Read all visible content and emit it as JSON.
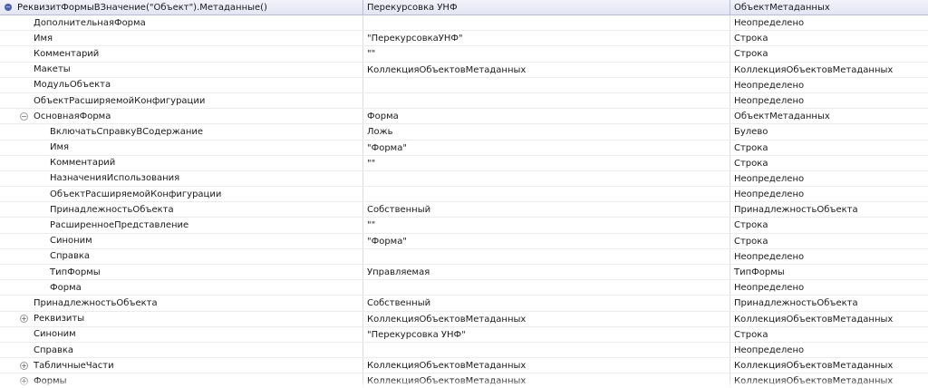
{
  "header": {
    "col1": "РеквизитФормыВЗначение(\"Объект\").Метаданные()",
    "col2": "Перекурсовка УНФ",
    "col3": "ОбъектМетаданных"
  },
  "rows": [
    {
      "level": 1,
      "toggle": "",
      "name": "ДополнительнаяФорма",
      "value": "",
      "type": "Неопределено"
    },
    {
      "level": 1,
      "toggle": "",
      "name": "Имя",
      "value": "\"ПерекурсовкаУНФ\"",
      "type": "Строка"
    },
    {
      "level": 1,
      "toggle": "",
      "name": "Комментарий",
      "value": "\"\"",
      "type": "Строка"
    },
    {
      "level": 1,
      "toggle": "",
      "name": "Макеты",
      "value": "КоллекцияОбъектовМетаданных",
      "type": "КоллекцияОбъектовМетаданных"
    },
    {
      "level": 1,
      "toggle": "",
      "name": "МодульОбъекта",
      "value": "",
      "type": "Неопределено"
    },
    {
      "level": 1,
      "toggle": "",
      "name": "ОбъектРасширяемойКонфигурации",
      "value": "",
      "type": "Неопределено"
    },
    {
      "level": 1,
      "toggle": "⊖",
      "name": "ОсновнаяФорма",
      "value": "Форма",
      "type": "ОбъектМетаданных"
    },
    {
      "level": 2,
      "toggle": "",
      "name": "ВключатьСправкуВСодержание",
      "value": "Ложь",
      "type": "Булево"
    },
    {
      "level": 2,
      "toggle": "",
      "name": "Имя",
      "value": "\"Форма\"",
      "type": "Строка"
    },
    {
      "level": 2,
      "toggle": "",
      "name": "Комментарий",
      "value": "\"\"",
      "type": "Строка"
    },
    {
      "level": 2,
      "toggle": "",
      "name": "НазначенияИспользования",
      "value": "",
      "type": "Неопределено"
    },
    {
      "level": 2,
      "toggle": "",
      "name": "ОбъектРасширяемойКонфигурации",
      "value": "",
      "type": "Неопределено"
    },
    {
      "level": 2,
      "toggle": "",
      "name": "ПринадлежностьОбъекта",
      "value": "Собственный",
      "type": "ПринадлежностьОбъекта"
    },
    {
      "level": 2,
      "toggle": "",
      "name": "РасширенноеПредставление",
      "value": "\"\"",
      "type": "Строка"
    },
    {
      "level": 2,
      "toggle": "",
      "name": "Синоним",
      "value": "\"Форма\"",
      "type": "Строка"
    },
    {
      "level": 2,
      "toggle": "",
      "name": "Справка",
      "value": "",
      "type": "Неопределено"
    },
    {
      "level": 2,
      "toggle": "",
      "name": "ТипФормы",
      "value": "Управляемая",
      "type": "ТипФормы"
    },
    {
      "level": 2,
      "toggle": "",
      "name": "Форма",
      "value": "",
      "type": "Неопределено"
    },
    {
      "level": 1,
      "toggle": "",
      "name": "ПринадлежностьОбъекта",
      "value": "Собственный",
      "type": "ПринадлежностьОбъекта"
    },
    {
      "level": 1,
      "toggle": "⊕",
      "name": "Реквизиты",
      "value": "КоллекцияОбъектовМетаданных",
      "type": "КоллекцияОбъектовМетаданных"
    },
    {
      "level": 1,
      "toggle": "",
      "name": "Синоним",
      "value": "\"Перекурсовка УНФ\"",
      "type": "Строка"
    },
    {
      "level": 1,
      "toggle": "",
      "name": "Справка",
      "value": "",
      "type": "Неопределено"
    },
    {
      "level": 1,
      "toggle": "⊕",
      "name": "ТабличныеЧасти",
      "value": "КоллекцияОбъектовМетаданных",
      "type": "КоллекцияОбъектовМетаданных"
    },
    {
      "level": 1,
      "toggle": "⊕",
      "name": "Формы",
      "value": "КоллекцияОбъектовМетаданных",
      "type": "КоллекцияОбъектовМетаданных"
    }
  ]
}
